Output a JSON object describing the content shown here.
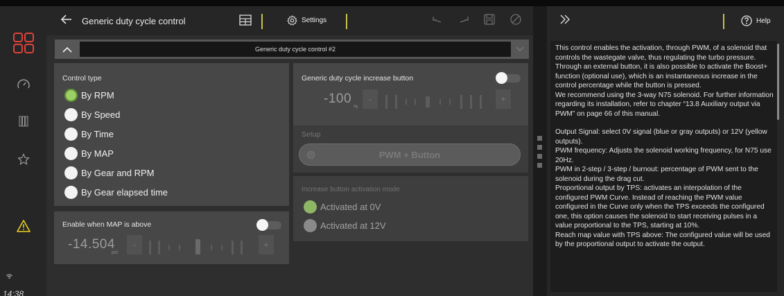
{
  "statusbar": {
    "time": "14:38"
  },
  "rail": {
    "items": [
      {
        "icon": "grid-logo-icon"
      },
      {
        "icon": "speedometer-icon"
      },
      {
        "icon": "gauges-icon"
      },
      {
        "icon": "star-icon"
      },
      {
        "icon": "warning-icon"
      }
    ]
  },
  "toolbar": {
    "title": "Generic duty cycle control",
    "settings_label": "Settings"
  },
  "subheader": {
    "name": "Generic duty cycle control #2"
  },
  "control_type": {
    "label": "Control type",
    "options": [
      "By RPM",
      "By Speed",
      "By Time",
      "By MAP",
      "By Gear and RPM",
      "By Gear elapsed time"
    ],
    "selected": "By RPM"
  },
  "map_enable": {
    "label": "Enable when MAP is above",
    "toggle": false,
    "value": "-14.504",
    "unit": "psi"
  },
  "increase_button": {
    "label": "Generic duty cycle increase button",
    "toggle": false,
    "value": "-100",
    "unit": "%"
  },
  "setup": {
    "label": "Setup",
    "button_label": "PWM + Button"
  },
  "activation_mode": {
    "label": "Increase button activation mode",
    "options": [
      "Activated at 0V",
      "Activated at 12V"
    ],
    "selected": "Activated at 0V"
  },
  "help": {
    "button_label": "Help",
    "paragraphs": [
      "This control enables the activation, through PWM, of a solenoid that controls the wastegate valve, thus regulating the turbo pressure. Through an external button, it is also possible to activate the Boost+ function (optional use), which is an instantaneous increase in the control percentage while the button is pressed.",
      "We recommend using the 3-way N75 solenoid. For further information regarding its installation, refer to chapter “13.8 Auxiliary output via PWM” on page 66 of this manual.",
      "Output Signal: select 0V signal (blue or gray outputs) or 12V (yellow outputs).",
      "PWM frequency: Adjusts the solenoid working frequency, for N75 use 20Hz.",
      "PWM in 2-step / 3-step / burnout: percentage of PWM sent to the solenoid during the drag cut.",
      "Proportional output by TPS: activates an interpolation of the configured PWM Curve. Instead of reaching the PWM value configured in the Curve only when the TPS exceeds the configured one, this option causes the solenoid to start receiving pulses in a value proportional to the TPS, starting at 10%.",
      "Reach map value with TPS above: The configured value will be used by the proportional output to activate the output."
    ]
  },
  "colors": {
    "accent": "#c8c24a",
    "selected_radio": "#9bd066",
    "warning": "#e8d21f",
    "logo": "#e0443a"
  }
}
